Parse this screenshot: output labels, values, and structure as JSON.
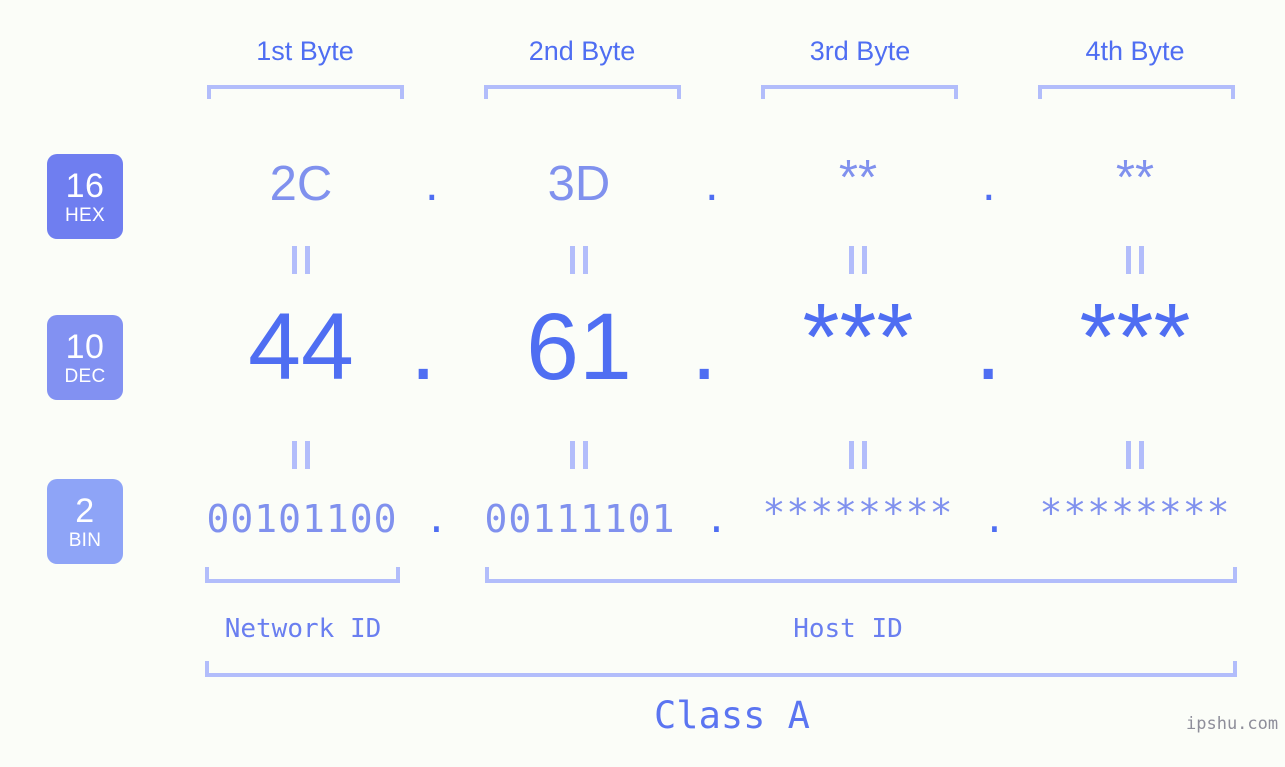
{
  "background_color": "#fbfdf8",
  "colors": {
    "accent_strong": "#4f6ef2",
    "accent_light": "#8091ee",
    "bracket": "#b2bdfb",
    "badge_hex": "#6f7ef0",
    "badge_dec": "#8291f2",
    "badge_bin": "#8ea4f7",
    "watermark": "#8e8e9a"
  },
  "byte_headers": [
    {
      "label": "1st Byte"
    },
    {
      "label": "2nd Byte"
    },
    {
      "label": "3rd Byte"
    },
    {
      "label": "4th Byte"
    }
  ],
  "rows": [
    {
      "badge": {
        "number": "16",
        "name": "HEX"
      },
      "values": [
        "2C",
        "3D",
        "**",
        "**"
      ],
      "separator": "."
    },
    {
      "badge": {
        "number": "10",
        "name": "DEC"
      },
      "values": [
        "44",
        "61",
        "***",
        "***"
      ],
      "separator": "."
    },
    {
      "badge": {
        "number": "2",
        "name": "BIN"
      },
      "values": [
        "00101100",
        "00111101",
        "********",
        "********"
      ],
      "separator": "."
    }
  ],
  "equivalence_symbol": "=",
  "sections": [
    {
      "label": "Network ID"
    },
    {
      "label": "Host ID"
    }
  ],
  "class": {
    "label": "Class A"
  },
  "watermark": {
    "text": "ipshu.com"
  }
}
